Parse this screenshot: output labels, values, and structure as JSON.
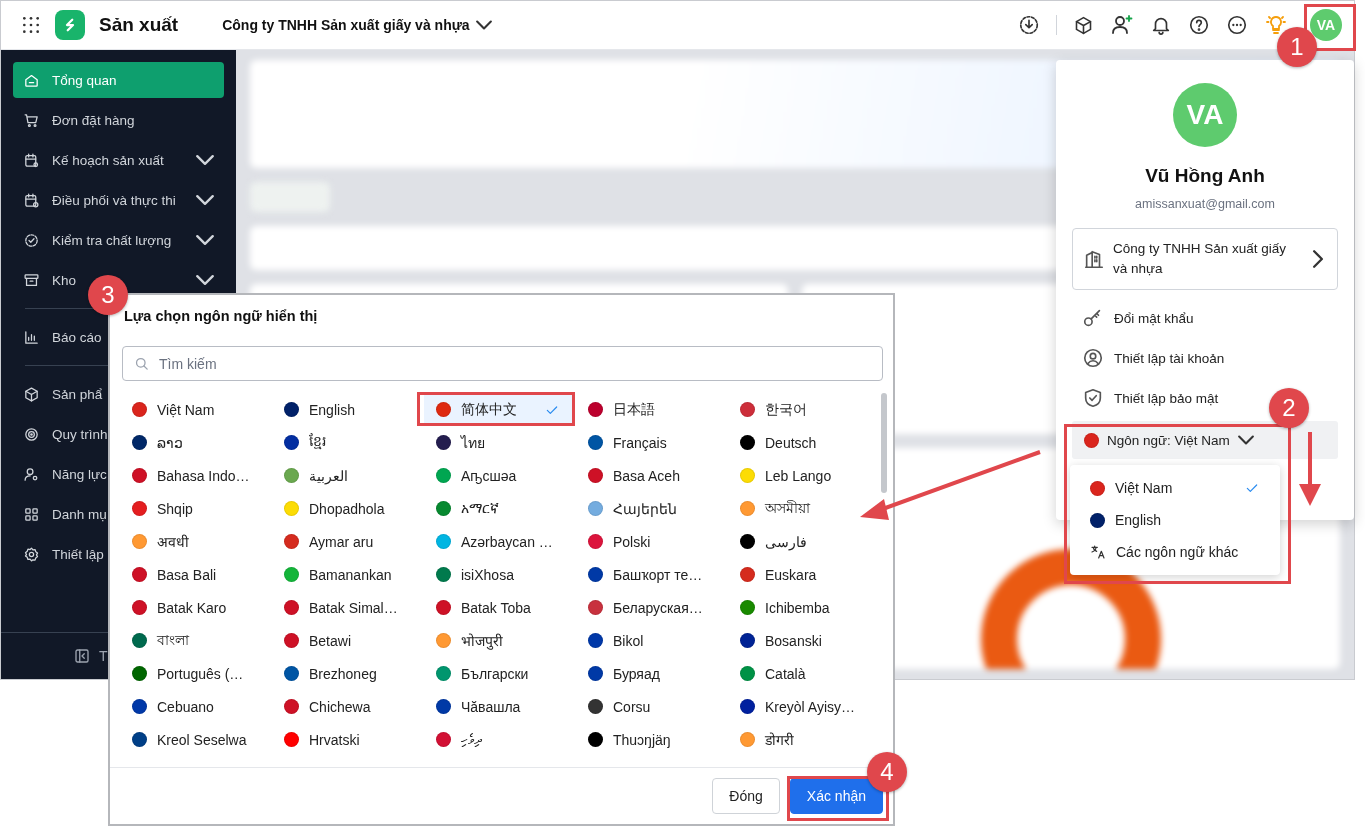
{
  "topbar": {
    "app_name": "Sản xuất",
    "company": "Công ty TNHH Sản xuất giấy và nhựa",
    "avatar": "VA"
  },
  "sidebar": {
    "sections": [
      [
        {
          "label": "Tổng quan",
          "kind": "link",
          "selected": true
        },
        {
          "label": "Đơn đặt hàng",
          "kind": "link",
          "selected": false
        },
        {
          "label": "Kế hoạch sản xuất",
          "kind": "group",
          "selected": false
        },
        {
          "label": "Điều phối và thực thi",
          "kind": "group",
          "selected": false
        },
        {
          "label": "Kiểm tra chất lượng",
          "kind": "group",
          "selected": false
        },
        {
          "label": "Kho",
          "kind": "group",
          "selected": false
        }
      ],
      [
        {
          "label": "Báo cáo",
          "kind": "link",
          "selected": false
        }
      ],
      [
        {
          "label": "Sản phẩ",
          "kind": "link",
          "selected": false
        },
        {
          "label": "Quy trình",
          "kind": "link",
          "selected": false
        },
        {
          "label": "Năng lực",
          "kind": "link",
          "selected": false
        },
        {
          "label": "Danh mụ",
          "kind": "link",
          "selected": false
        },
        {
          "label": "Thiết lập",
          "kind": "link",
          "selected": false
        }
      ]
    ],
    "collapse_label": "T"
  },
  "profile": {
    "avatar": "VA",
    "name": "Vũ Hồng Anh",
    "email": "amissanxuat@gmail.com",
    "company": "Công ty TNHH Sản xuất giấy và nhựa",
    "menu": [
      "Đổi mật khẩu",
      "Thiết lập tài khoản",
      "Thiết lập bảo mật"
    ],
    "language": {
      "label": "Ngôn ngữ: Việt Nam",
      "color": "#da251d"
    },
    "language_options": [
      {
        "label": "Việt Nam",
        "kind": "flag",
        "color": "#da251d",
        "selected": true
      },
      {
        "label": "English",
        "kind": "flag",
        "color": "#012169",
        "selected": false
      },
      {
        "label": "Các ngôn ngữ khác",
        "kind": "more",
        "selected": false
      }
    ]
  },
  "dialog": {
    "title": "Lựa chọn ngôn ngữ hiển thị",
    "search": {
      "placeholder": "Tìm kiếm"
    },
    "languages": [
      {
        "label": "Việt Nam",
        "color": "#da251d",
        "selected": false
      },
      {
        "label": "English",
        "color": "#012169",
        "selected": false
      },
      {
        "label": "简体中文",
        "color": "#de2910",
        "selected": true
      },
      {
        "label": "日本語",
        "color": "#bc002d",
        "selected": false
      },
      {
        "label": "한국어",
        "color": "#cd2e3a",
        "selected": false
      },
      {
        "label": "ລາວ",
        "color": "#002868",
        "selected": false
      },
      {
        "label": "ខ្មែរ",
        "color": "#032ea1",
        "selected": false
      },
      {
        "label": "ไทย",
        "color": "#241d4f",
        "selected": false
      },
      {
        "label": "Français",
        "color": "#0055a4",
        "selected": false
      },
      {
        "label": "Deutsch",
        "color": "#000000",
        "selected": false
      },
      {
        "label": "Bahasa Indo…",
        "color": "#ce1126",
        "selected": false
      },
      {
        "label": "العربية",
        "color": "#6aa84f",
        "selected": false
      },
      {
        "label": "Аҧсшәа",
        "color": "#00a651",
        "selected": false
      },
      {
        "label": "Basa Aceh",
        "color": "#ce1126",
        "selected": false
      },
      {
        "label": "Leb Lango",
        "color": "#fcdc04",
        "selected": false
      },
      {
        "label": "Shqip",
        "color": "#e41e20",
        "selected": false
      },
      {
        "label": "Dhopadhola",
        "color": "#fcdc04",
        "selected": false
      },
      {
        "label": "አማርኛ",
        "color": "#078930",
        "selected": false
      },
      {
        "label": "Հայերեն",
        "color": "#74acdf",
        "selected": false
      },
      {
        "label": "অসমীয়া",
        "color": "#ff9933",
        "selected": false
      },
      {
        "label": "अवधी",
        "color": "#ff9933",
        "selected": false
      },
      {
        "label": "Aymar aru",
        "color": "#d52b1e",
        "selected": false
      },
      {
        "label": "Azərbaycan …",
        "color": "#00b5e2",
        "selected": false
      },
      {
        "label": "Polski",
        "color": "#dc143c",
        "selected": false
      },
      {
        "label": "فارسی",
        "color": "#000000",
        "selected": false
      },
      {
        "label": "Basa Bali",
        "color": "#ce1126",
        "selected": false
      },
      {
        "label": "Bamanankan",
        "color": "#14b53a",
        "selected": false
      },
      {
        "label": "isiXhosa",
        "color": "#007a4d",
        "selected": false
      },
      {
        "label": "Башҡорт те…",
        "color": "#0039a6",
        "selected": false
      },
      {
        "label": "Euskara",
        "color": "#d52b1e",
        "selected": false
      },
      {
        "label": "Batak Karo",
        "color": "#ce1126",
        "selected": false
      },
      {
        "label": "Batak Simal…",
        "color": "#ce1126",
        "selected": false
      },
      {
        "label": "Batak Toba",
        "color": "#ce1126",
        "selected": false
      },
      {
        "label": "Беларуская…",
        "color": "#c8313e",
        "selected": false
      },
      {
        "label": "Ichibemba",
        "color": "#198a00",
        "selected": false
      },
      {
        "label": "বাংলা",
        "color": "#006a4e",
        "selected": false
      },
      {
        "label": "Betawi",
        "color": "#ce1126",
        "selected": false
      },
      {
        "label": "भोजपुरी",
        "color": "#ff9933",
        "selected": false
      },
      {
        "label": "Bikol",
        "color": "#0038a8",
        "selected": false
      },
      {
        "label": "Bosanski",
        "color": "#002395",
        "selected": false
      },
      {
        "label": "Português (…",
        "color": "#006600",
        "selected": false
      },
      {
        "label": "Brezhoneg",
        "color": "#0055a4",
        "selected": false
      },
      {
        "label": "Български",
        "color": "#00966e",
        "selected": false
      },
      {
        "label": "Буряад",
        "color": "#0039a6",
        "selected": false
      },
      {
        "label": "Català",
        "color": "#009246",
        "selected": false
      },
      {
        "label": "Cebuano",
        "color": "#0038a8",
        "selected": false
      },
      {
        "label": "Chichewa",
        "color": "#ce1126",
        "selected": false
      },
      {
        "label": "Чăвашла",
        "color": "#0039a6",
        "selected": false
      },
      {
        "label": "Corsu",
        "color": "#333333",
        "selected": false
      },
      {
        "label": "Kreyòl Ayisy…",
        "color": "#00209f",
        "selected": false
      },
      {
        "label": "Kreol Seselwa",
        "color": "#003f87",
        "selected": false
      },
      {
        "label": "Hrvatski",
        "color": "#ff0000",
        "selected": false
      },
      {
        "label": "ދިވެހި",
        "color": "#d21034",
        "selected": false
      },
      {
        "label": "Thuɔŋjäŋ",
        "color": "#000000",
        "selected": false
      },
      {
        "label": "डोगरी",
        "color": "#ff9933",
        "selected": false
      }
    ],
    "buttons": [
      {
        "label": "Đóng",
        "kind": "secondary"
      },
      {
        "label": "Xác nhận",
        "kind": "primary"
      }
    ]
  },
  "callouts": [
    "1",
    "2",
    "3",
    "4"
  ]
}
